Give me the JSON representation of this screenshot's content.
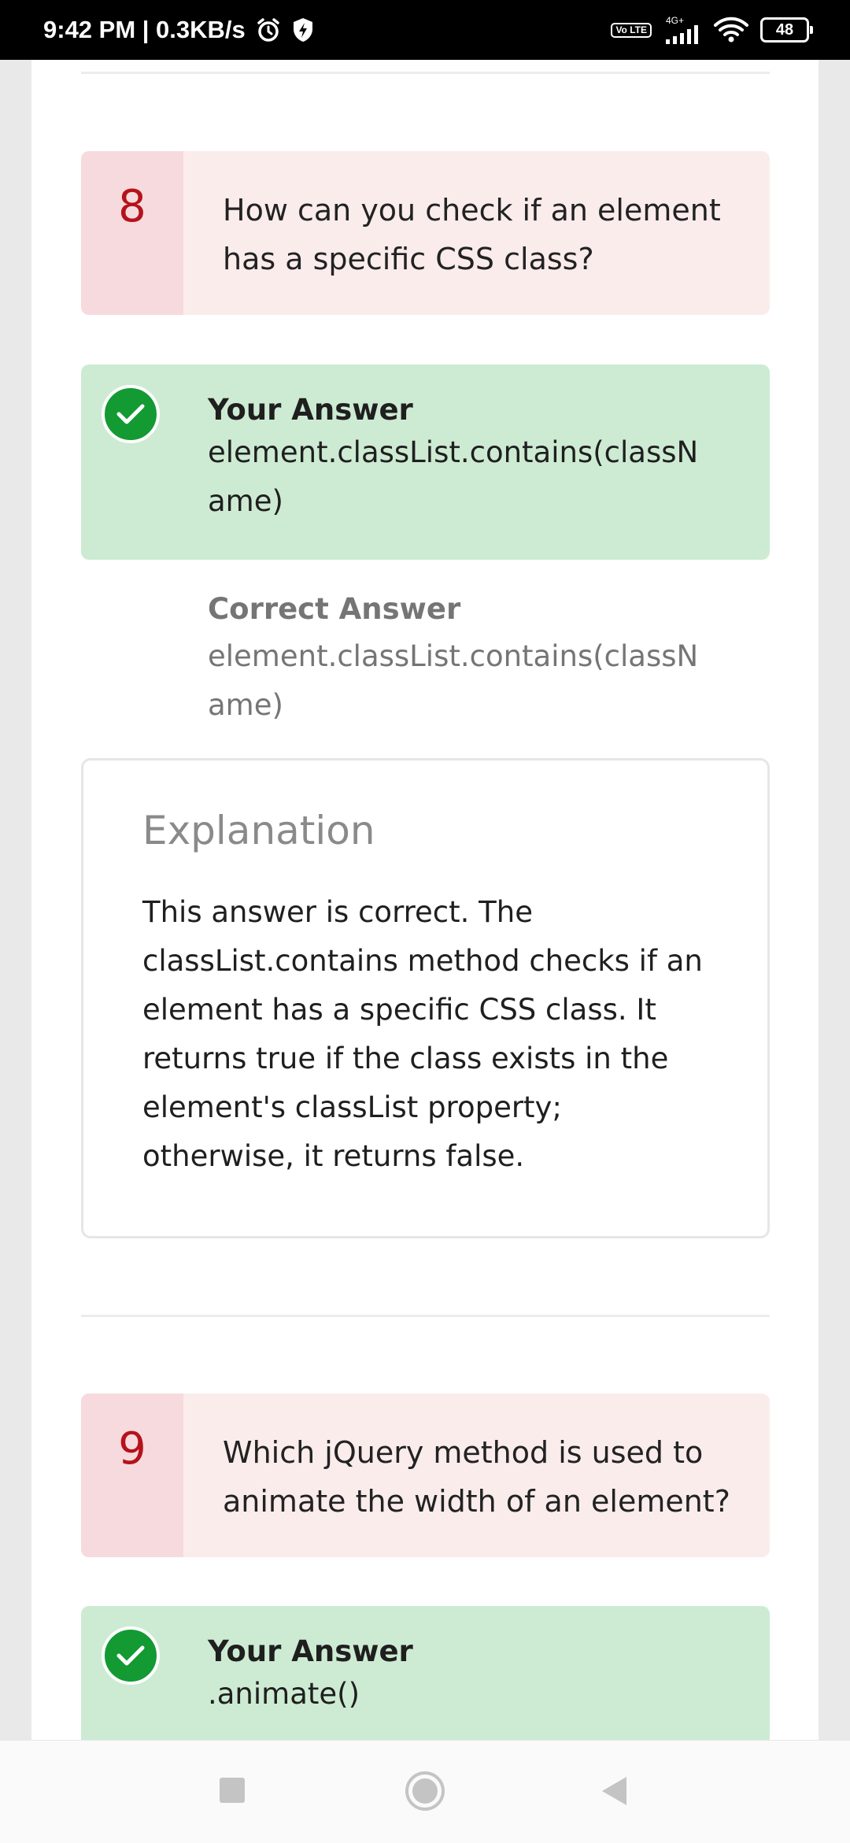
{
  "status_bar": {
    "time_speed": "9:42 PM | 0.3KB/s",
    "volte": "Vo LTE",
    "network": "4G+",
    "battery": "48"
  },
  "questions": [
    {
      "number": "8",
      "text": "How can you check if an element has a specific CSS class?",
      "your_answer_label": "Your Answer",
      "your_answer": "element.classList.contains(className)",
      "correct_answer_label": "Correct Answer",
      "correct_answer": "element.classList.contains(className)",
      "explanation_title": "Explanation",
      "explanation": "This answer is correct. The classList.contains method checks if an element has a specific CSS class. It returns true if the class exists in the element's classList property; otherwise, it returns false."
    },
    {
      "number": "9",
      "text": "Which jQuery method is used to animate the width of an element?",
      "your_answer_label": "Your Answer",
      "your_answer": ".animate()"
    }
  ],
  "icons": {
    "alarm": "alarm-icon",
    "shield": "shield-icon",
    "wifi": "wifi-icon",
    "check": "check-icon",
    "nav_recent": "square-icon",
    "nav_home": "circle-icon",
    "nav_back": "triangle-back-icon"
  },
  "colors": {
    "question_bg": "#fbecec",
    "question_number": "#b5121b",
    "answer_bg": "#cdebd3",
    "check_green": "#139a32"
  }
}
